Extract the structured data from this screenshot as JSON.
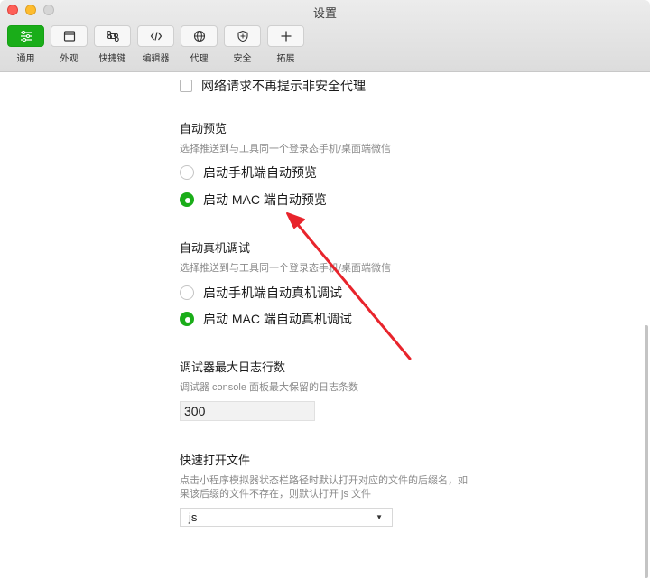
{
  "window": {
    "title": "设置"
  },
  "toolbar": {
    "items": [
      {
        "label": "通用",
        "icon": "list-settings-icon",
        "active": true
      },
      {
        "label": "外观",
        "icon": "window-icon",
        "active": false
      },
      {
        "label": "快捷键",
        "icon": "command-key-icon",
        "active": false
      },
      {
        "label": "编辑器",
        "icon": "code-icon",
        "active": false
      },
      {
        "label": "代理",
        "icon": "globe-icon",
        "active": false
      },
      {
        "label": "安全",
        "icon": "shield-icon",
        "active": false
      },
      {
        "label": "拓展",
        "icon": "plus-icon",
        "active": false
      }
    ]
  },
  "settings": {
    "proxy_checkbox": {
      "label": "网络请求不再提示非安全代理",
      "checked": false
    },
    "auto_preview": {
      "title": "自动预览",
      "desc": "选择推送到与工具同一个登录态手机/桌面端微信",
      "options": [
        {
          "label": "启动手机端自动预览",
          "checked": false
        },
        {
          "label": "启动 MAC 端自动预览",
          "checked": true
        }
      ]
    },
    "auto_debug": {
      "title": "自动真机调试",
      "desc": "选择推送到与工具同一个登录态手机/桌面端微信",
      "options": [
        {
          "label": "启动手机端自动真机调试",
          "checked": false
        },
        {
          "label": "启动 MAC 端自动真机调试",
          "checked": true
        }
      ]
    },
    "debugger_log": {
      "title": "调试器最大日志行数",
      "desc": "调试器 console 面板最大保留的日志条数",
      "value": "300"
    },
    "quick_open": {
      "title": "快速打开文件",
      "desc_line1": "点击小程序模拟器状态栏路径时默认打开对应的文件的后缀名，如",
      "desc_line2": "果该后缀的文件不存在，则默认打开 js 文件",
      "selected": "js"
    }
  },
  "colors": {
    "accent": "#1aad19",
    "annotation_arrow": "#e8242c"
  }
}
